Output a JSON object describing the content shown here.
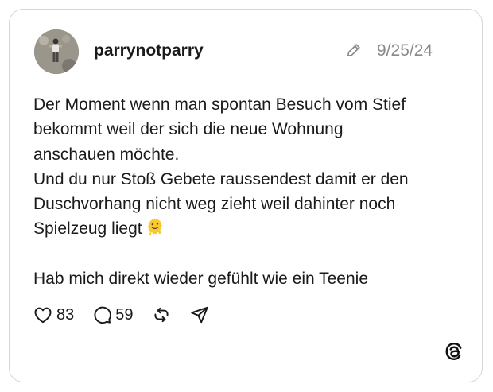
{
  "post": {
    "username": "parrynotparry",
    "date": "9/25/24",
    "lines": [
      "Der Moment wenn man spontan Besuch vom Stief",
      "bekommt weil der sich die neue Wohnung",
      "anschauen möchte.",
      "Und du nur Stoß Gebete raussendest damit er den",
      "Duschvorhang nicht weg zieht weil dahinter noch",
      "Spielzeug liegt",
      "",
      "Hab mich direkt wieder gefühlt wie ein Teenie"
    ],
    "emoji": "melting-face"
  },
  "actions": {
    "likes": "83",
    "replies": "59"
  },
  "icons": {
    "like": "heart-icon",
    "reply": "comment-icon",
    "repost": "repost-icon",
    "share": "send-icon",
    "edit": "pencil-icon",
    "brand": "threads-logo"
  },
  "colors": {
    "text": "#1a1a1a",
    "muted": "#8a8a8a",
    "border": "#d6d6d6"
  }
}
